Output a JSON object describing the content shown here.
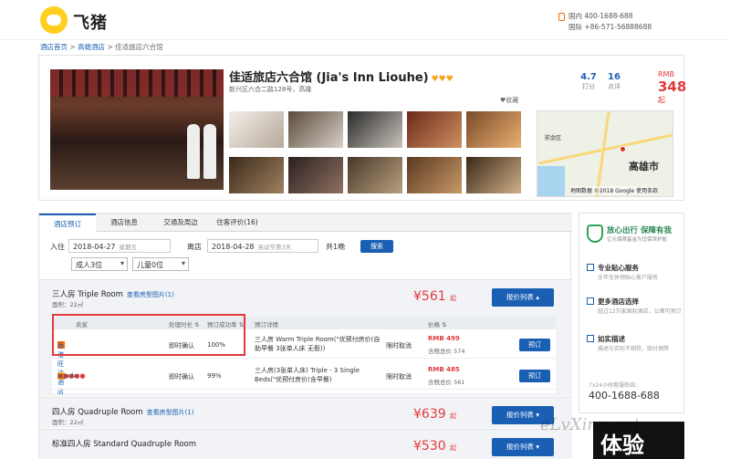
{
  "header": {
    "logo_text": "飞猪",
    "domestic_label": "国内",
    "domestic_phone": "400-1688-688",
    "intl_label": "国际",
    "intl_phone": "+86-571-56888688"
  },
  "breadcrumb": {
    "home": "酒店首页",
    "sep1": " > ",
    "city": "高雄酒店",
    "sep2": " > ",
    "current": "佳适旅店六合馆"
  },
  "hotel": {
    "name": "佳适旅店六合馆 (Jia's Inn Liouhe)",
    "stars": "♥♥♥",
    "address": "新兴区六合二路128号，高雄",
    "favorite": "♥收藏",
    "score": "4.7",
    "score_label": "打分",
    "reviews": "16",
    "reviews_label": "点评",
    "price_prefix": "RMB",
    "price": "348",
    "price_suffix": "起"
  },
  "map": {
    "city_label": "高雄市",
    "area_label": "前金区",
    "copyright": "地图数据 ©2018 Google  使用条款"
  },
  "tabs": [
    "酒店预订",
    "酒店信息",
    "交通及周边",
    "住客评价(16)"
  ],
  "search": {
    "checkin_label": "入住",
    "checkin_date": "2018-04-27",
    "checkin_week": "星期五",
    "checkout_label": "离店",
    "checkout_date": "2018-04-28",
    "checkout_note": "另动节第3天",
    "nights": "共1晚",
    "search_button": "搜索",
    "adults": "成人3位",
    "children": "儿童0位"
  },
  "rooms": [
    {
      "name": "三人房 Triple Room",
      "photos_link": "查看房型图片(1)",
      "area": "面积：22㎡",
      "price": "¥561",
      "price_suffix": "起",
      "list_button": "报价列表 ▴"
    },
    {
      "name": "四人房 Quadruple Room",
      "photos_link": "查看房型图片(1)",
      "area": "面积：22㎡",
      "price": "¥639",
      "price_suffix": "起",
      "list_button": "报价列表 ▾"
    },
    {
      "name": "标准四人房 Standard Quadruple Room",
      "photos_link": "",
      "area": "",
      "price": "¥530",
      "price_suffix": "起",
      "list_button": "报价列表 ▾"
    }
  ],
  "vendor_table": {
    "headers": {
      "seller": "卖家",
      "confirm": "处理时长 ⇅",
      "rate": "预订成功率 ⇅",
      "details": "预订详情",
      "price": "价格 ⇅"
    },
    "rows": [
      {
        "seller": "香港旺达酒店专营店",
        "confirm": "即时确认",
        "rate": "100%",
        "details": "三人房 Warm Triple Room(\"优预付房价(自助早餐 3张单人床 无假))",
        "cancel": "限时取消",
        "price": "RMB 499",
        "total": "含税总价 574",
        "book": "预订"
      },
      {
        "seller": "agoda",
        "confirm": "即时确认",
        "rate": "99%",
        "details": "三人房(3张单人床) Triple - 3 Single Beds(\"优预付房价(含早餐)",
        "cancel": "限时取消",
        "price": "RMB 485",
        "total": "含税总价 561",
        "book": "预订"
      }
    ]
  },
  "sidebar": {
    "title": "放心出行 保障有我",
    "subtitle": "亿元保障基金为您保驾护航",
    "items": [
      {
        "title": "专业贴心服务",
        "desc": "全年无休预贴心客户服务"
      },
      {
        "title": "更多酒店选择",
        "desc": "超过12万家国际酒店，公寓可预订"
      },
      {
        "title": "如实描述",
        "desc": "描述与实际不相符，赔付保障"
      }
    ],
    "phone_label": "7x24小时客服热线：",
    "phone": "400-1688-688"
  },
  "promo": {
    "text": "体验"
  },
  "watermark": "eLvXing.net"
}
